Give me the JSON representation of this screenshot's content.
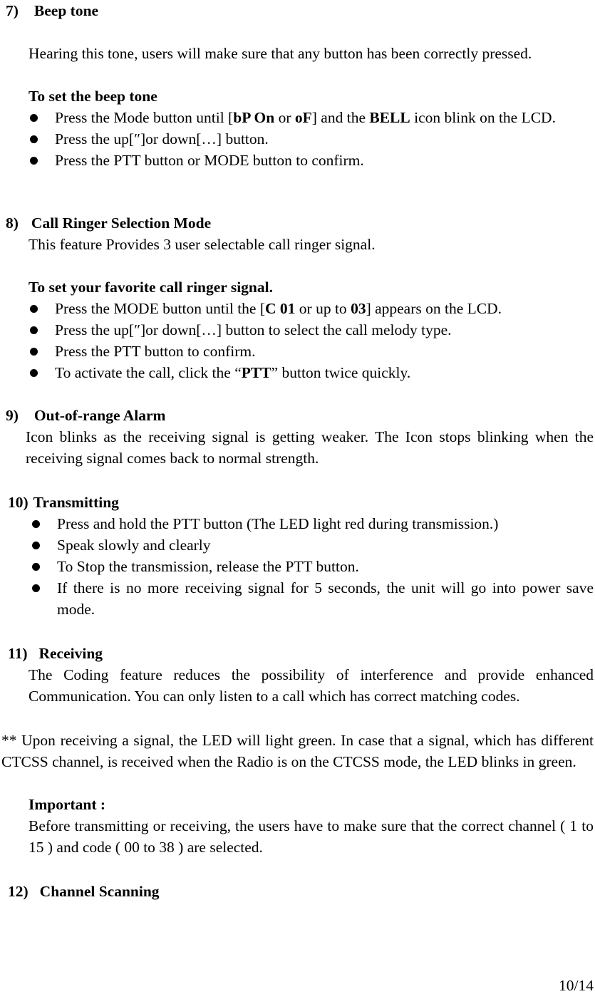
{
  "page": {
    "footer_page_number": "10/14"
  },
  "sections": [
    {
      "number": "7)",
      "title": "Beep tone",
      "intro": "Hearing this tone, users will make sure that any button has been correctly pressed.",
      "subhead": "To set the beep tone",
      "bullets": [
        {
          "pre": "Press the Mode button until [",
          "tok1": "bP On",
          "mid1": " or ",
          "tok2": "oF",
          "mid2": "] and the ",
          "tok3": "BELL",
          "post": " icon blink on the LCD."
        },
        {
          "text": "Press the up[″]or down[…]  button."
        },
        {
          "text": "Press the PTT button or MODE button to confirm."
        }
      ]
    },
    {
      "number": "8)",
      "title": "Call Ringer Selection Mode",
      "intro": "This feature Provides 3 user selectable call ringer signal.",
      "subhead": "To set your favorite call ringer signal.",
      "bullets": [
        {
          "pre": "Press the MODE button until the [",
          "tok1": "C 01",
          "mid1": " or up to ",
          "tok2": "03",
          "post": "] appears on the LCD."
        },
        {
          "text": "Press the up[″]or down[…] button to select the call melody type."
        },
        {
          "text": "Press the PTT button to confirm."
        },
        {
          "pre": "To activate the call, click the “",
          "tok1": "PTT",
          "post": "” button twice quickly."
        }
      ]
    },
    {
      "number": "9)",
      "title": "Out-of-range Alarm",
      "intro": "Icon blinks as the receiving signal is getting weaker. The Icon stops blinking when the receiving signal comes back to normal strength."
    },
    {
      "number": "10)",
      "title": "Transmitting",
      "bullets": [
        {
          "text": "Press and hold the PTT button (The LED light red during transmission.)"
        },
        {
          "text": "Speak slowly and clearly"
        },
        {
          "text": "To Stop the transmission, release the PTT button."
        },
        {
          "text": "If there is no more receiving signal for 5 seconds, the unit will go into power save mode."
        }
      ]
    },
    {
      "number": "11)",
      "title": "Receiving",
      "intro": "The Coding feature reduces the possibility of interference and provide enhanced Communication. You can only listen to a call which has correct matching codes."
    },
    {
      "number": "12)",
      "title": "Channel Scanning"
    }
  ],
  "notes": {
    "double_star_note": "** Upon receiving a signal, the LED will light green. In case that a signal, which has different CTCSS channel, is received when the Radio is on the CTCSS mode, the LED blinks in green.",
    "important_label": "Important :",
    "important_body": "Before transmitting or receiving, the users have to make sure that the correct channel ( 1 to 15 ) and code ( 00 to 38 ) are selected."
  }
}
